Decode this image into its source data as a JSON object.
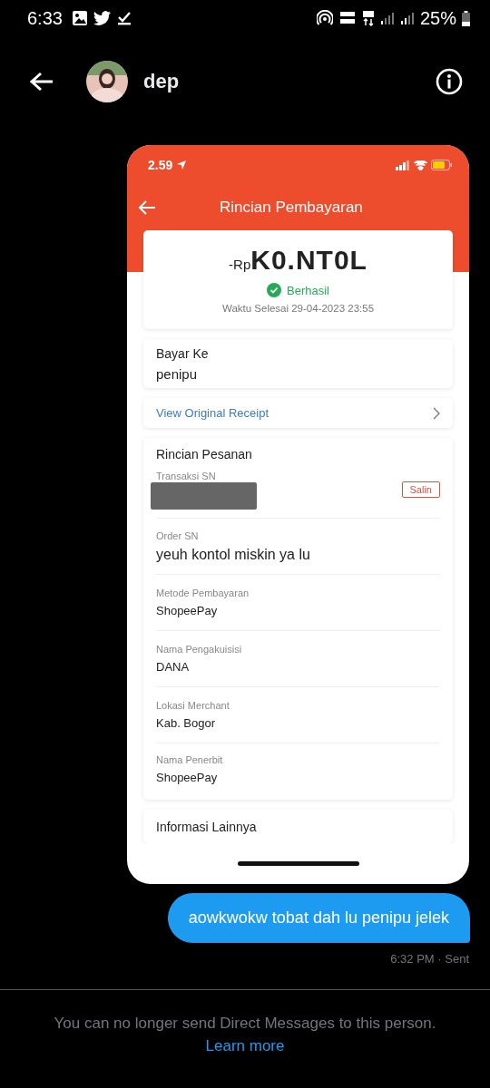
{
  "status_bar": {
    "time": "6:33",
    "battery": "25%"
  },
  "header": {
    "name": "dep"
  },
  "shared_screenshot": {
    "status_time": "2.59",
    "title": "Rincian Pembayaran",
    "amount_prefix": "-Rp",
    "amount": "K0.NT0L",
    "status": "Berhasil",
    "completed": "Waktu Selesai 29-04-2023 23:55",
    "pay_to": {
      "label": "Bayar Ke",
      "value": "penipu"
    },
    "receipt_link": "View Original Receipt",
    "order_details": {
      "title": "Rincian Pesanan",
      "fields": [
        {
          "kind": "redacted",
          "label": "Transaksi SN",
          "button": "Salin"
        },
        {
          "kind": "large",
          "label": "Order SN",
          "value": "yeuh kontol miskin ya lu"
        },
        {
          "kind": "plain",
          "label": "Metode Pembayaran",
          "value": "ShopeePay"
        },
        {
          "kind": "plain",
          "label": "Nama Pengakuisisi",
          "value": "DANA"
        },
        {
          "kind": "plain",
          "label": "Lokasi Merchant",
          "value": "Kab. Bogor"
        },
        {
          "kind": "plain",
          "label": "Nama Penerbit",
          "value": "ShopeePay"
        }
      ]
    },
    "next_section": "Informasi Lainnya"
  },
  "message": {
    "text": "aowkwokw tobat dah lu penipu jelek",
    "meta": "6:32 PM · Sent"
  },
  "notice": {
    "text": "You can no longer send Direct Messages to this person.",
    "link": "Learn more"
  }
}
